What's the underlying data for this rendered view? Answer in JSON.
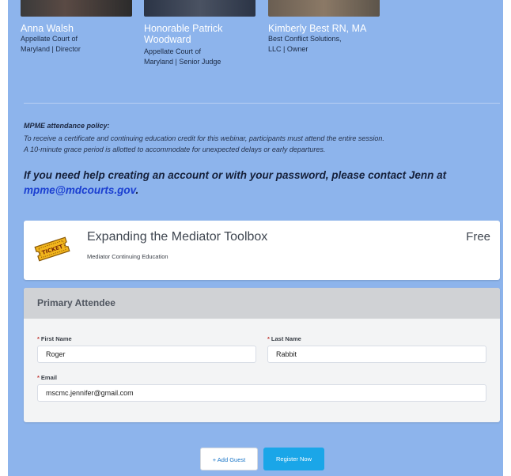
{
  "speakers": [
    {
      "name_line1": "Anna Walsh",
      "name_line2": "",
      "role_lines": [
        "Appellate Court of",
        "Maryland | Director"
      ]
    },
    {
      "name_line1": "Honorable Patrick",
      "name_line2": "Woodward",
      "role_lines": [
        "Appellate Court of",
        "Maryland | Senior Judge"
      ]
    },
    {
      "name_line1": "Kimberly Best RN, MA",
      "name_line2": "",
      "role_lines": [
        "Best Conflict Solutions,",
        "LLC | Owner"
      ]
    }
  ],
  "policy": {
    "title": "MPME attendance policy:",
    "line1": "To receive a certificate and continuing education credit for this webinar, participants must attend the entire session.",
    "line2": "A 10-minute grace period is allotted to accommodate for unexpected delays or early departures."
  },
  "help": {
    "text": "If you need help creating an account or with your password, please contact Jenn at",
    "email": "mpme@mdcourts.gov",
    "suffix": "."
  },
  "ticket": {
    "title": "Expanding the Mediator Toolbox",
    "subtitle": "Mediator Continuing Education",
    "price": "Free",
    "icon": "ticket-icon",
    "icon_text": "TICKET"
  },
  "attendee": {
    "header": "Primary Attendee",
    "required_marker": "*",
    "first_name_label": "First Name",
    "first_name_value": "Roger",
    "last_name_label": "Last Name",
    "last_name_value": "Rabbit",
    "email_label": "Email",
    "email_value": "mscmc.jennifer@gmail.com"
  },
  "buttons": {
    "add_guest": "+ Add Guest",
    "register": "Register Now"
  },
  "colors": {
    "background": "#8db4ec",
    "register_button": "#1aa6e8",
    "link": "#1b3fd1",
    "required": "#c23934"
  }
}
